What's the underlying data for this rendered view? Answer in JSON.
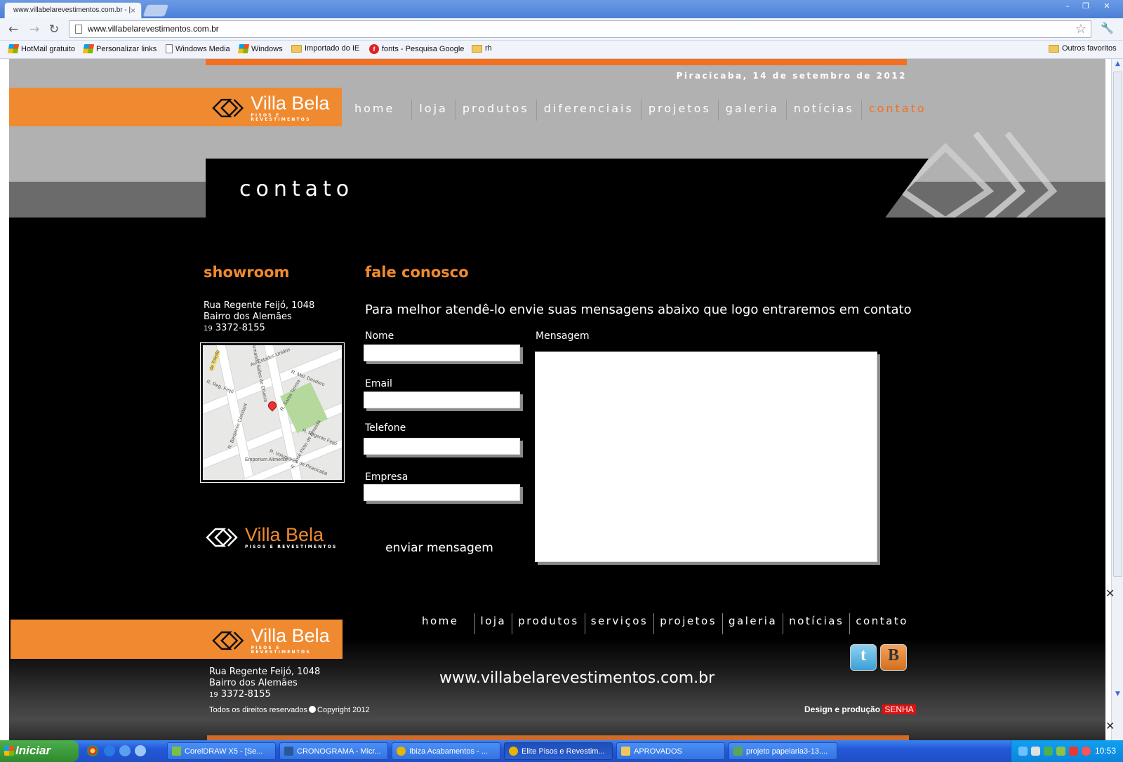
{
  "browser": {
    "tab_title": "www.villabelarevestimentos.com.br - |",
    "tab_close": "×",
    "url": "www.villabelarevestimentos.com.br",
    "window_controls": [
      "–",
      "❐",
      "✕"
    ],
    "bookmarks": [
      {
        "label": "HotMail gratuito",
        "icon": "windows-icon"
      },
      {
        "label": "Personalizar links",
        "icon": "windows-icon"
      },
      {
        "label": "Windows Media",
        "icon": "page-icon"
      },
      {
        "label": "Windows",
        "icon": "windows-icon"
      },
      {
        "label": "Importado do IE",
        "icon": "folder-icon"
      },
      {
        "label": "fonts - Pesquisa Google",
        "icon": "google-icon"
      },
      {
        "label": "rh",
        "icon": "folder-icon"
      }
    ],
    "other_bookmarks": "Outros favoritos"
  },
  "site": {
    "date": "Piracicaba, 14 de setembro de 2012",
    "logo": {
      "name": "Villa Bela",
      "sub": "PISOS E REVESTIMENTOS"
    },
    "nav": [
      "home",
      "loja",
      "produtos",
      "diferenciais",
      "projetos",
      "galeria",
      "notícias",
      "contato"
    ],
    "nav_active": "contato",
    "page_title": "contato",
    "showroom": {
      "title": "showroom",
      "street": "Rua Regente Feijó, 1048",
      "district": "Bairro dos Alemães",
      "ddd": "19",
      "phone": "3372-8155"
    },
    "map_labels": [
      "Av. Estados Unidos",
      "R. Mal. Deodoro",
      "R. Reg. Feijó",
      "R. Regente Feijó",
      "R. Benjamin Constant",
      "R. Voluntários de Piracicaba",
      "R. José Pinto de Almeida",
      "R. Santa Teresa",
      "Emporium Alimente",
      "de Toledo",
      "Armando Salles de Oliveira"
    ],
    "contact": {
      "title": "fale conosco",
      "intro": "Para melhor atendê-lo envie suas mensagens abaixo que logo entraremos em contato",
      "fields": {
        "name": "Nome",
        "email": "Email",
        "phone": "Telefone",
        "company": "Empresa",
        "message": "Mensagem"
      },
      "send": "enviar mensagem"
    },
    "footer": {
      "nav": [
        "home",
        "loja",
        "produtos",
        "serviços",
        "projetos",
        "galeria",
        "notícias",
        "contato"
      ],
      "street": "Rua Regente Feijó, 1048",
      "district": "Bairro dos Alemães",
      "ddd": "19",
      "phone": "3372-8155",
      "url": "www.villabelarevestimentos.com.br",
      "rights_a": "Todos os direitos reservados",
      "rights_b": "Copyright 2012",
      "design": "Design e produção",
      "design_brand": "SENHA",
      "social": {
        "twitter": "t",
        "blogger": "B"
      }
    }
  },
  "taskbar": {
    "start": "Iniciar",
    "tasks": [
      {
        "label": "CorelDRAW X5 - [Se...",
        "color": "#7ac142"
      },
      {
        "label": "CRONOGRAMA - Micr...",
        "color": "#2b5797"
      },
      {
        "label": "Ibiza Acabamentos - ...",
        "color": "#e8b400"
      },
      {
        "label": "Elite Pisos e Revestim...",
        "color": "#e8b400"
      },
      {
        "label": "APROVADOS",
        "color": "#f1c75b"
      },
      {
        "label": "projeto papelaria3-13....",
        "color": "#5aa55a"
      }
    ],
    "clock": "10:53"
  },
  "colors": {
    "orange": "#f08a30",
    "active_orange": "#f37021",
    "gray": "#b1b1b1",
    "black": "#000000"
  }
}
